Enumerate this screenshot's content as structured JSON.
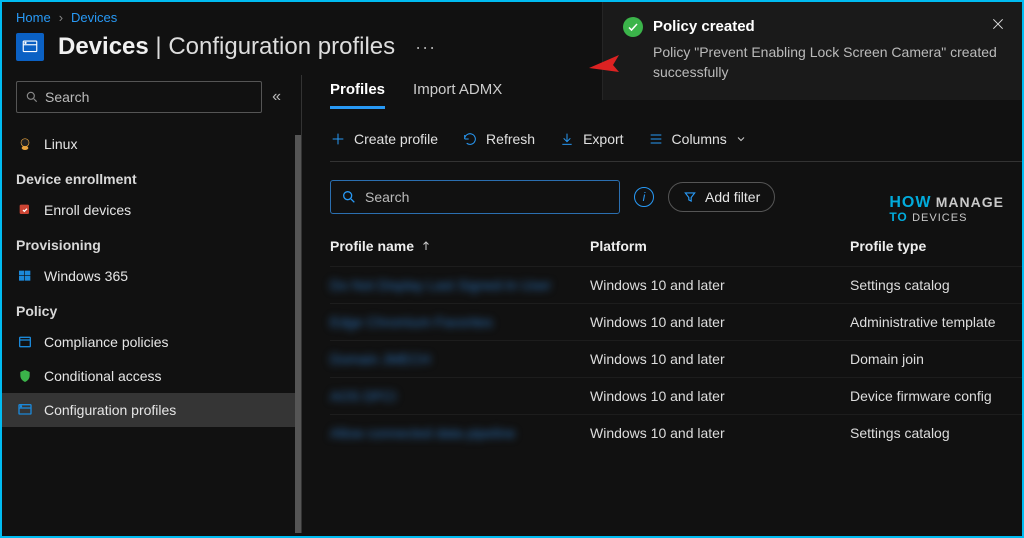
{
  "breadcrumb": {
    "home": "Home",
    "devices": "Devices"
  },
  "header": {
    "title": "Devices",
    "subtitle": "Configuration profiles"
  },
  "toast": {
    "title": "Policy created",
    "message": "Policy \"Prevent Enabling Lock Screen Camera\" created successfully"
  },
  "sidebar": {
    "search_placeholder": "Search",
    "items": [
      {
        "label": "Linux"
      }
    ],
    "group_enroll": "Device enrollment",
    "enroll_items": [
      {
        "label": "Enroll devices"
      }
    ],
    "group_prov": "Provisioning",
    "prov_items": [
      {
        "label": "Windows 365"
      }
    ],
    "group_policy": "Policy",
    "policy_items": [
      {
        "label": "Compliance policies"
      },
      {
        "label": "Conditional access"
      },
      {
        "label": "Configuration profiles"
      }
    ]
  },
  "tabs": {
    "profiles": "Profiles",
    "import": "Import ADMX"
  },
  "toolbar": {
    "create": "Create profile",
    "refresh": "Refresh",
    "export": "Export",
    "columns": "Columns"
  },
  "filter": {
    "search_placeholder": "Search",
    "add_filter": "Add filter"
  },
  "table": {
    "col_name": "Profile name",
    "col_platform": "Platform",
    "col_type": "Profile type",
    "rows": [
      {
        "name": "Do Not Display Last Signed-In User",
        "platform": "Windows 10 and later",
        "type": "Settings catalog"
      },
      {
        "name": "Edge Chromium Favorites",
        "platform": "Windows 10 and later",
        "type": "Administrative template"
      },
      {
        "name": "Domain JMECH",
        "platform": "Windows 10 and later",
        "type": "Domain join"
      },
      {
        "name": "AOS DFCI",
        "platform": "Windows 10 and later",
        "type": "Device firmware config"
      },
      {
        "name": "Allow connected data pipeline",
        "platform": "Windows 10 and later",
        "type": "Settings catalog"
      }
    ]
  },
  "watermark": {
    "how": "HOW",
    "to": "TO",
    "manage": "MANAGE",
    "devices": "DEVICES"
  }
}
